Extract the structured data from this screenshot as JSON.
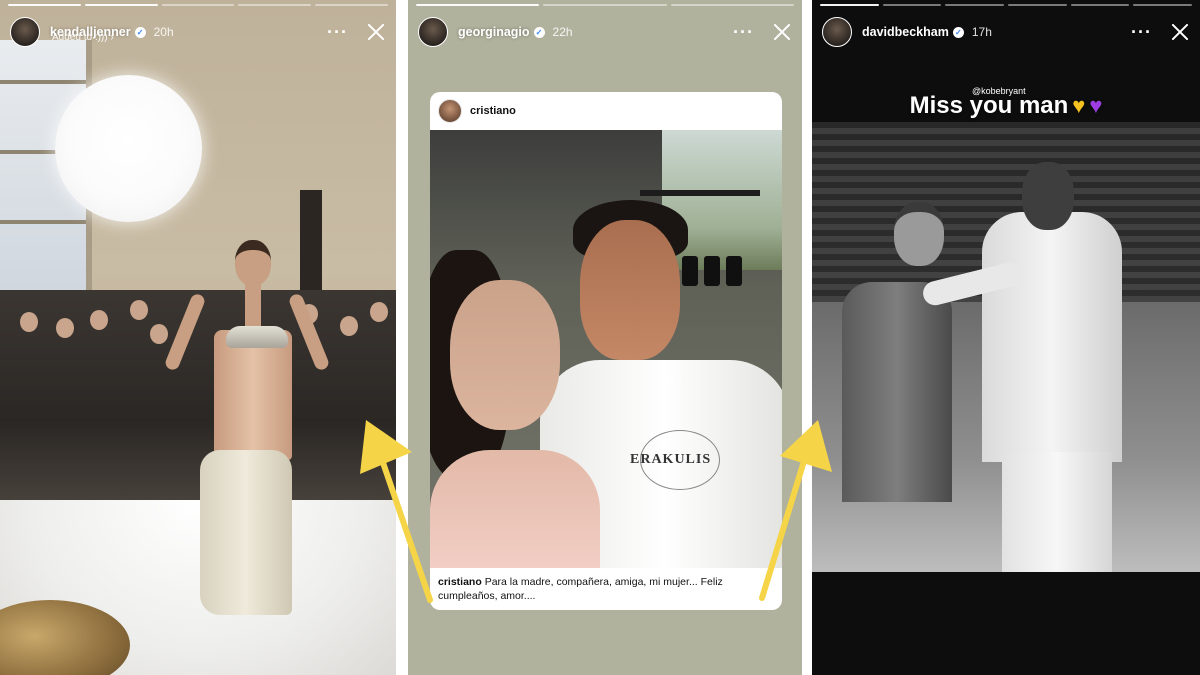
{
  "stories": [
    {
      "username": "kendalljenner",
      "time": "20h",
      "subtitle": "Added to :))) ›"
    },
    {
      "username": "georginagio",
      "time": "22h",
      "shared_post": {
        "username": "cristiano",
        "shirt_text": "ERAKULIS",
        "caption_user": "cristiano",
        "caption_text": "Para la madre, compañera, amiga, mi mujer... Feliz cumpleaños, amor...."
      }
    },
    {
      "username": "davidbeckham",
      "time": "17h",
      "mention": "@kobebryant",
      "caption": "Miss you man"
    }
  ],
  "icons": {
    "more": "more-horizontal-icon",
    "close": "close-icon",
    "verified": "verified-badge-icon",
    "heart_yellow": "yellow-heart-emoji",
    "heart_purple": "purple-heart-emoji"
  },
  "colors": {
    "arrow": "#f5d547",
    "verified_blue": "#3a86ff"
  }
}
